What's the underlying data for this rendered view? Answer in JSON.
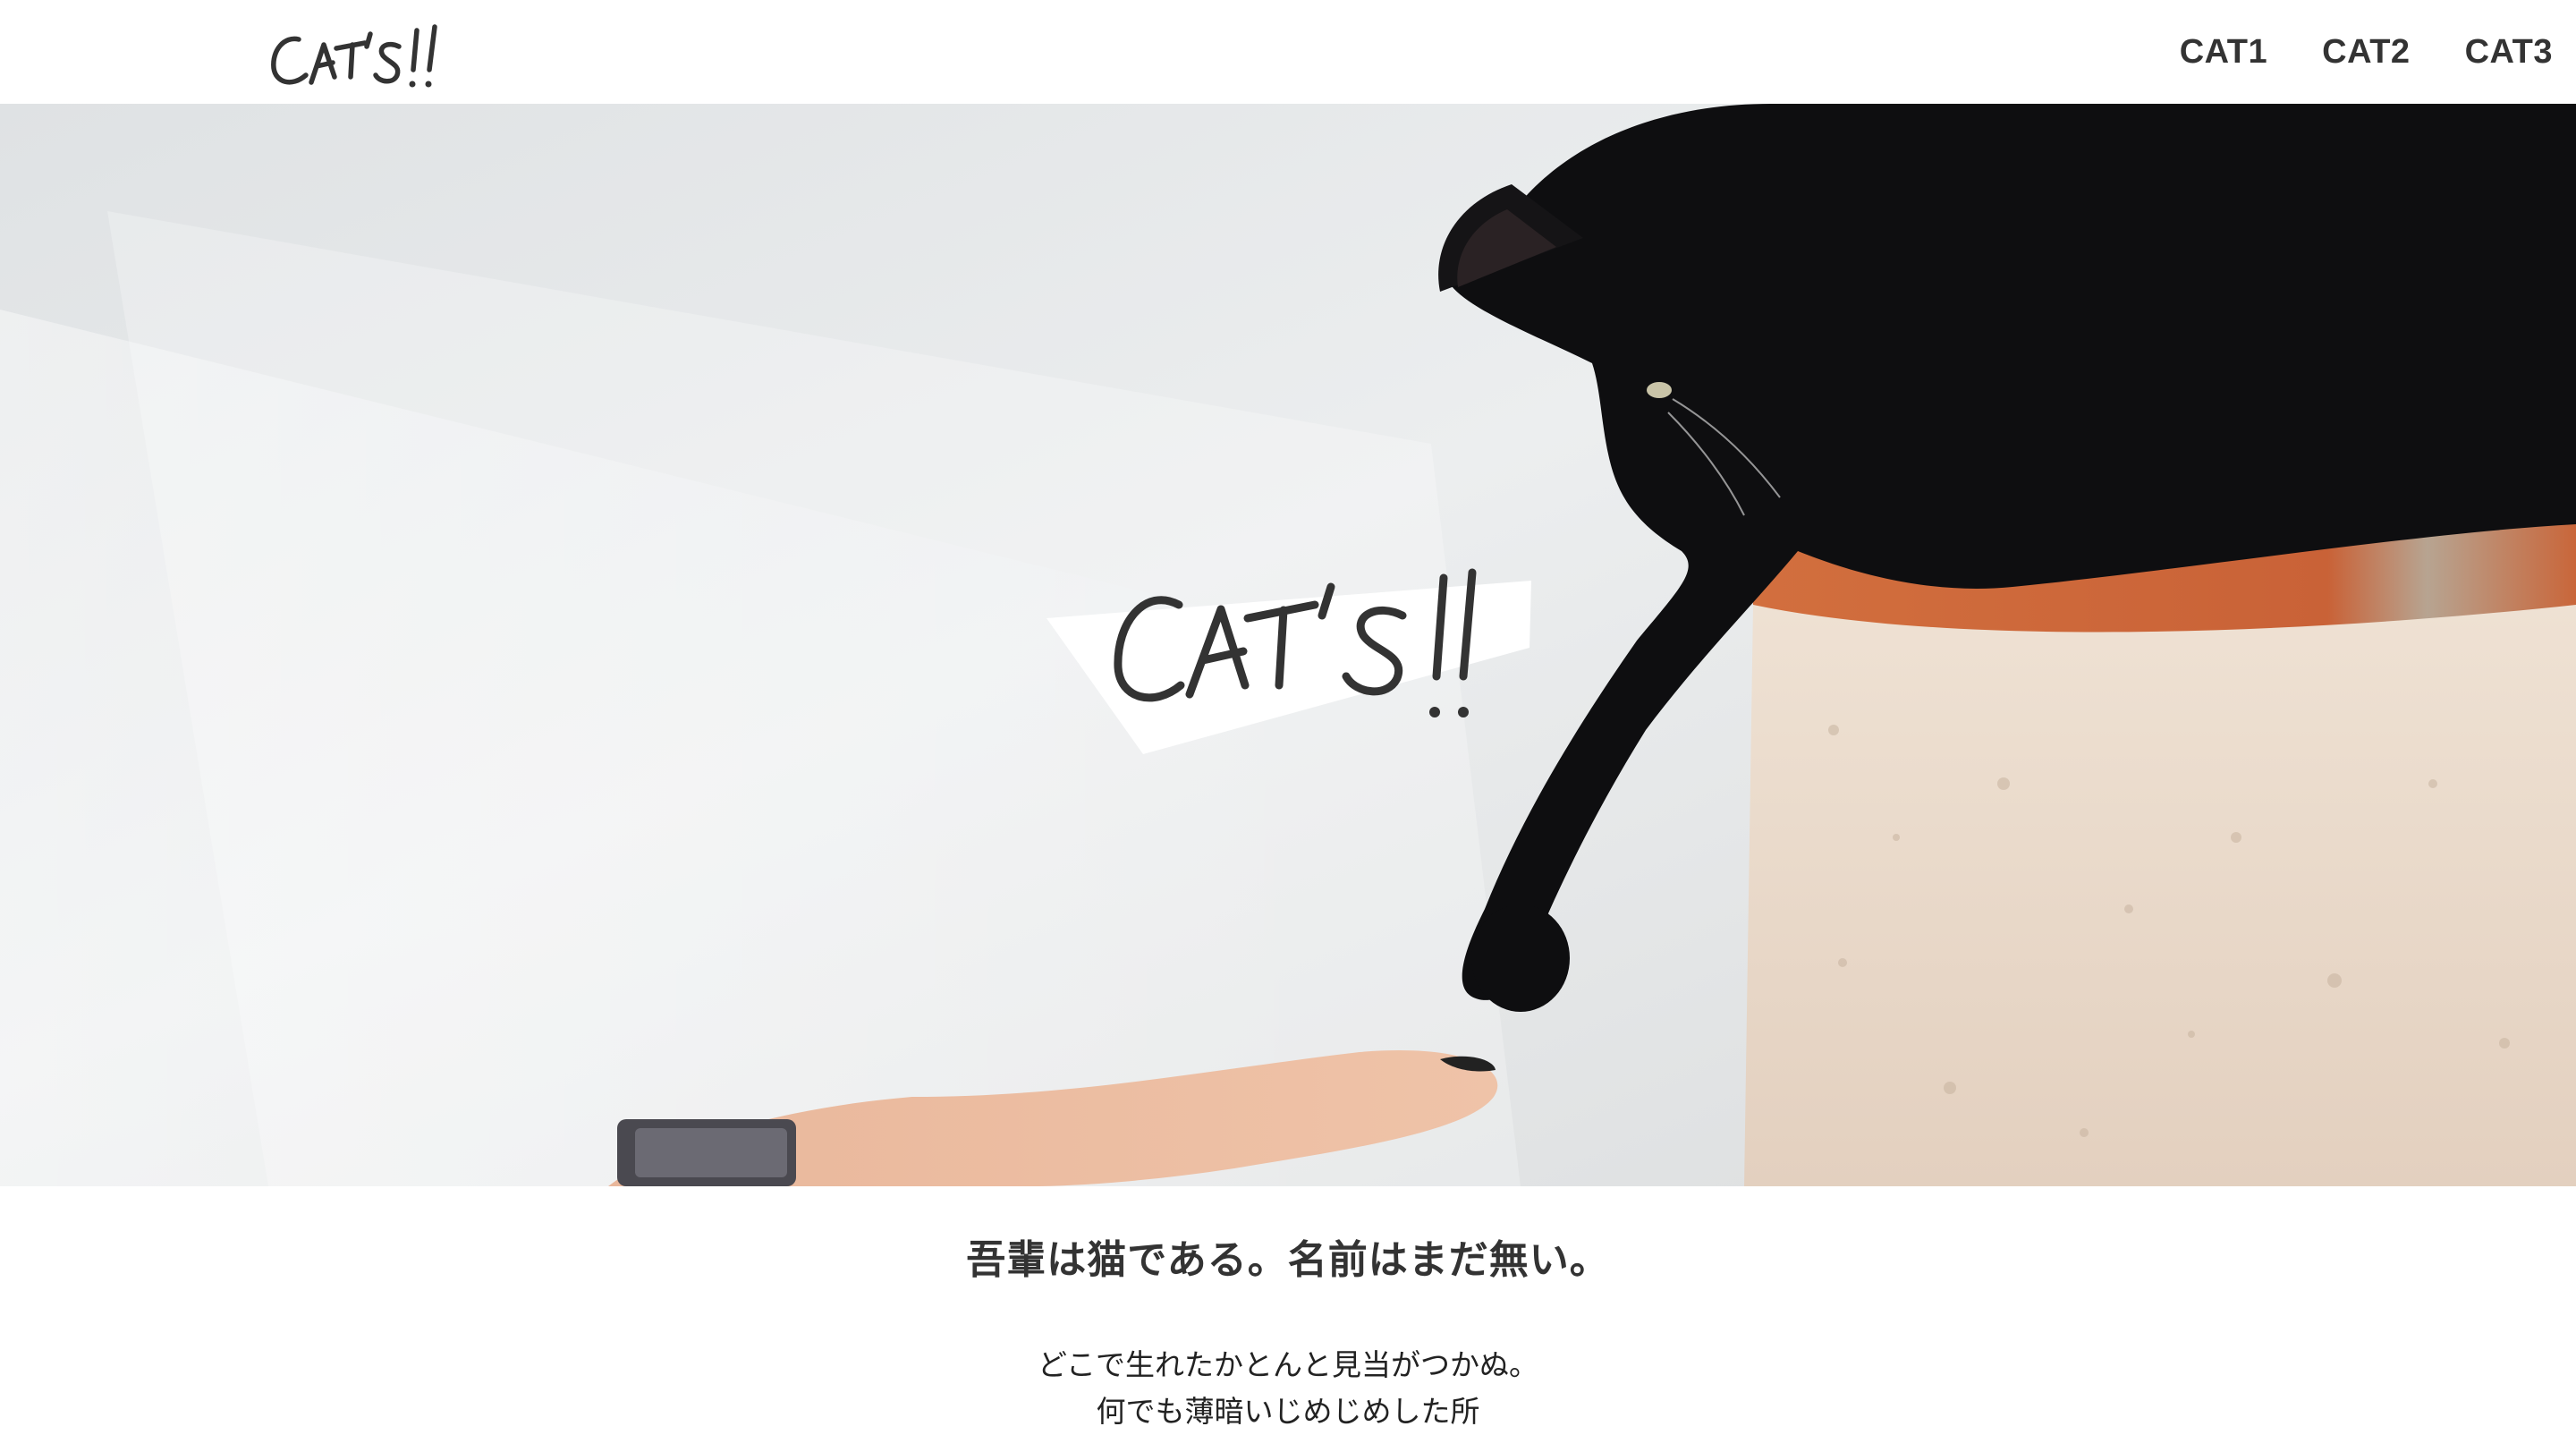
{
  "header": {
    "logo_text": "CAT'S!!",
    "nav": [
      {
        "label": "CAT1"
      },
      {
        "label": "CAT2"
      },
      {
        "label": "CAT3"
      }
    ]
  },
  "hero": {
    "logo_text": "CAT'S!!",
    "image_description_icon": "black-cat-reaching-hand-photo"
  },
  "content": {
    "tagline": "吾輩は猫である。名前はまだ無い。",
    "paragraphs": [
      "どこで生れたかとんと見当がつかぬ。",
      "何でも薄暗いじめじめした所"
    ]
  },
  "colors": {
    "text": "#333333",
    "background": "#ffffff",
    "hero_wall": "#e4e6e7",
    "brick": "#c9663a",
    "plaster": "#e9d9c9",
    "cat": "#0e0e10"
  }
}
